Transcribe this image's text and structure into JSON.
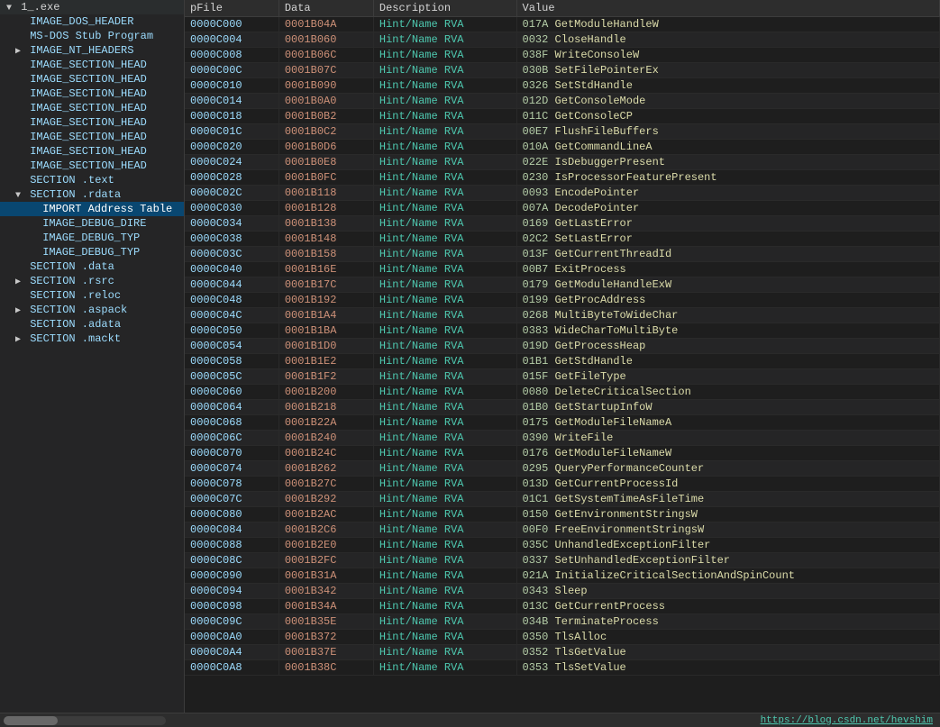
{
  "tree": {
    "root": "1_.exe",
    "items": [
      {
        "id": "dos-header",
        "label": "IMAGE_DOS_HEADER",
        "indent": 1,
        "expandable": false,
        "selected": false
      },
      {
        "id": "ms-dos-stub",
        "label": "MS-DOS Stub Program",
        "indent": 1,
        "expandable": false,
        "selected": false
      },
      {
        "id": "nt-headers",
        "label": "IMAGE_NT_HEADERS",
        "indent": 1,
        "expandable": true,
        "expanded": false,
        "selected": false
      },
      {
        "id": "section-head-1",
        "label": "IMAGE_SECTION_HEAD",
        "indent": 1,
        "expandable": false,
        "selected": false
      },
      {
        "id": "section-head-2",
        "label": "IMAGE_SECTION_HEAD",
        "indent": 1,
        "expandable": false,
        "selected": false
      },
      {
        "id": "section-head-3",
        "label": "IMAGE_SECTION_HEAD",
        "indent": 1,
        "expandable": false,
        "selected": false
      },
      {
        "id": "section-head-4",
        "label": "IMAGE_SECTION_HEAD",
        "indent": 1,
        "expandable": false,
        "selected": false
      },
      {
        "id": "section-head-5",
        "label": "IMAGE_SECTION_HEAD",
        "indent": 1,
        "expandable": false,
        "selected": false
      },
      {
        "id": "section-head-6",
        "label": "IMAGE_SECTION_HEAD",
        "indent": 1,
        "expandable": false,
        "selected": false
      },
      {
        "id": "section-head-7",
        "label": "IMAGE_SECTION_HEAD",
        "indent": 1,
        "expandable": false,
        "selected": false
      },
      {
        "id": "section-head-8",
        "label": "IMAGE_SECTION_HEAD",
        "indent": 1,
        "expandable": false,
        "selected": false
      },
      {
        "id": "section-text",
        "label": "SECTION .text",
        "indent": 1,
        "expandable": false,
        "selected": false
      },
      {
        "id": "section-rdata",
        "label": "SECTION .rdata",
        "indent": 1,
        "expandable": true,
        "expanded": true,
        "selected": false
      },
      {
        "id": "import-addr-table",
        "label": "IMPORT Address Table",
        "indent": 2,
        "expandable": false,
        "selected": true
      },
      {
        "id": "image-debug-dir",
        "label": "IMAGE_DEBUG_DIRE",
        "indent": 2,
        "expandable": false,
        "selected": false
      },
      {
        "id": "image-debug-typ1",
        "label": "IMAGE_DEBUG_TYP",
        "indent": 2,
        "expandable": false,
        "selected": false
      },
      {
        "id": "image-debug-typ2",
        "label": "IMAGE_DEBUG_TYP",
        "indent": 2,
        "expandable": false,
        "selected": false
      },
      {
        "id": "section-data",
        "label": "SECTION .data",
        "indent": 1,
        "expandable": false,
        "selected": false
      },
      {
        "id": "section-rsrc",
        "label": "SECTION .rsrc",
        "indent": 1,
        "expandable": true,
        "expanded": false,
        "selected": false
      },
      {
        "id": "section-reloc",
        "label": "SECTION .reloc",
        "indent": 1,
        "expandable": false,
        "selected": false
      },
      {
        "id": "section-aspack",
        "label": "SECTION .aspack",
        "indent": 1,
        "expandable": true,
        "expanded": false,
        "selected": false
      },
      {
        "id": "section-adata",
        "label": "SECTION .adata",
        "indent": 1,
        "expandable": false,
        "selected": false
      },
      {
        "id": "section-mackt",
        "label": "SECTION .mackt",
        "indent": 1,
        "expandable": true,
        "expanded": false,
        "selected": false
      }
    ]
  },
  "table": {
    "headers": [
      "pFile",
      "Data",
      "Description",
      "Value"
    ],
    "rows": [
      {
        "pfile": "0000C000",
        "data": "0001B04A",
        "desc": "Hint/Name RVA",
        "val_id": "017A",
        "func": "GetModuleHandleW"
      },
      {
        "pfile": "0000C004",
        "data": "0001B060",
        "desc": "Hint/Name RVA",
        "val_id": "0032",
        "func": "CloseHandle"
      },
      {
        "pfile": "0000C008",
        "data": "0001B06C",
        "desc": "Hint/Name RVA",
        "val_id": "038F",
        "func": "WriteConsoleW"
      },
      {
        "pfile": "0000C00C",
        "data": "0001B07C",
        "desc": "Hint/Name RVA",
        "val_id": "030B",
        "func": "SetFilePointerEx"
      },
      {
        "pfile": "0000C010",
        "data": "0001B090",
        "desc": "Hint/Name RVA",
        "val_id": "0326",
        "func": "SetStdHandle"
      },
      {
        "pfile": "0000C014",
        "data": "0001B0A0",
        "desc": "Hint/Name RVA",
        "val_id": "012D",
        "func": "GetConsoleMode"
      },
      {
        "pfile": "0000C018",
        "data": "0001B0B2",
        "desc": "Hint/Name RVA",
        "val_id": "011C",
        "func": "GetConsoleCP"
      },
      {
        "pfile": "0000C01C",
        "data": "0001B0C2",
        "desc": "Hint/Name RVA",
        "val_id": "00E7",
        "func": "FlushFileBuffers"
      },
      {
        "pfile": "0000C020",
        "data": "0001B0D6",
        "desc": "Hint/Name RVA",
        "val_id": "010A",
        "func": "GetCommandLineA"
      },
      {
        "pfile": "0000C024",
        "data": "0001B0E8",
        "desc": "Hint/Name RVA",
        "val_id": "022E",
        "func": "IsDebuggerPresent"
      },
      {
        "pfile": "0000C028",
        "data": "0001B0FC",
        "desc": "Hint/Name RVA",
        "val_id": "0230",
        "func": "IsProcessorFeaturePresent"
      },
      {
        "pfile": "0000C02C",
        "data": "0001B118",
        "desc": "Hint/Name RVA",
        "val_id": "0093",
        "func": "EncodePointer"
      },
      {
        "pfile": "0000C030",
        "data": "0001B128",
        "desc": "Hint/Name RVA",
        "val_id": "007A",
        "func": "DecodePointer"
      },
      {
        "pfile": "0000C034",
        "data": "0001B138",
        "desc": "Hint/Name RVA",
        "val_id": "0169",
        "func": "GetLastError"
      },
      {
        "pfile": "0000C038",
        "data": "0001B148",
        "desc": "Hint/Name RVA",
        "val_id": "02C2",
        "func": "SetLastError"
      },
      {
        "pfile": "0000C03C",
        "data": "0001B158",
        "desc": "Hint/Name RVA",
        "val_id": "013F",
        "func": "GetCurrentThreadId"
      },
      {
        "pfile": "0000C040",
        "data": "0001B16E",
        "desc": "Hint/Name RVA",
        "val_id": "00B7",
        "func": "ExitProcess"
      },
      {
        "pfile": "0000C044",
        "data": "0001B17C",
        "desc": "Hint/Name RVA",
        "val_id": "0179",
        "func": "GetModuleHandleExW"
      },
      {
        "pfile": "0000C048",
        "data": "0001B192",
        "desc": "Hint/Name RVA",
        "val_id": "0199",
        "func": "GetProcAddress"
      },
      {
        "pfile": "0000C04C",
        "data": "0001B1A4",
        "desc": "Hint/Name RVA",
        "val_id": "0268",
        "func": "MultiByteToWideChar"
      },
      {
        "pfile": "0000C050",
        "data": "0001B1BA",
        "desc": "Hint/Name RVA",
        "val_id": "0383",
        "func": "WideCharToMultiByte"
      },
      {
        "pfile": "0000C054",
        "data": "0001B1D0",
        "desc": "Hint/Name RVA",
        "val_id": "019D",
        "func": "GetProcessHeap"
      },
      {
        "pfile": "0000C058",
        "data": "0001B1E2",
        "desc": "Hint/Name RVA",
        "val_id": "01B1",
        "func": "GetStdHandle"
      },
      {
        "pfile": "0000C05C",
        "data": "0001B1F2",
        "desc": "Hint/Name RVA",
        "val_id": "015F",
        "func": "GetFileType"
      },
      {
        "pfile": "0000C060",
        "data": "0001B200",
        "desc": "Hint/Name RVA",
        "val_id": "0080",
        "func": "DeleteCriticalSection"
      },
      {
        "pfile": "0000C064",
        "data": "0001B218",
        "desc": "Hint/Name RVA",
        "val_id": "01B0",
        "func": "GetStartupInfoW"
      },
      {
        "pfile": "0000C068",
        "data": "0001B22A",
        "desc": "Hint/Name RVA",
        "val_id": "0175",
        "func": "GetModuleFileNameA"
      },
      {
        "pfile": "0000C06C",
        "data": "0001B240",
        "desc": "Hint/Name RVA",
        "val_id": "0390",
        "func": "WriteFile"
      },
      {
        "pfile": "0000C070",
        "data": "0001B24C",
        "desc": "Hint/Name RVA",
        "val_id": "0176",
        "func": "GetModuleFileNameW"
      },
      {
        "pfile": "0000C074",
        "data": "0001B262",
        "desc": "Hint/Name RVA",
        "val_id": "0295",
        "func": "QueryPerformanceCounter"
      },
      {
        "pfile": "0000C078",
        "data": "0001B27C",
        "desc": "Hint/Name RVA",
        "val_id": "013D",
        "func": "GetCurrentProcessId"
      },
      {
        "pfile": "0000C07C",
        "data": "0001B292",
        "desc": "Hint/Name RVA",
        "val_id": "01C1",
        "func": "GetSystemTimeAsFileTime"
      },
      {
        "pfile": "0000C080",
        "data": "0001B2AC",
        "desc": "Hint/Name RVA",
        "val_id": "0150",
        "func": "GetEnvironmentStringsW"
      },
      {
        "pfile": "0000C084",
        "data": "0001B2C6",
        "desc": "Hint/Name RVA",
        "val_id": "00F0",
        "func": "FreeEnvironmentStringsW"
      },
      {
        "pfile": "0000C088",
        "data": "0001B2E0",
        "desc": "Hint/Name RVA",
        "val_id": "035C",
        "func": "UnhandledExceptionFilter"
      },
      {
        "pfile": "0000C08C",
        "data": "0001B2FC",
        "desc": "Hint/Name RVA",
        "val_id": "0337",
        "func": "SetUnhandledExceptionFilter"
      },
      {
        "pfile": "0000C090",
        "data": "0001B31A",
        "desc": "Hint/Name RVA",
        "val_id": "021A",
        "func": "InitializeCriticalSectionAndSpinCount"
      },
      {
        "pfile": "0000C094",
        "data": "0001B342",
        "desc": "Hint/Name RVA",
        "val_id": "0343",
        "func": "Sleep"
      },
      {
        "pfile": "0000C098",
        "data": "0001B34A",
        "desc": "Hint/Name RVA",
        "val_id": "013C",
        "func": "GetCurrentProcess"
      },
      {
        "pfile": "0000C09C",
        "data": "0001B35E",
        "desc": "Hint/Name RVA",
        "val_id": "034B",
        "func": "TerminateProcess"
      },
      {
        "pfile": "0000C0A0",
        "data": "0001B372",
        "desc": "Hint/Name RVA",
        "val_id": "0350",
        "func": "TlsAlloc"
      },
      {
        "pfile": "0000C0A4",
        "data": "0001B37E",
        "desc": "Hint/Name RVA",
        "val_id": "0352",
        "func": "TlsGetValue"
      },
      {
        "pfile": "0000C0A8",
        "data": "0001B38C",
        "desc": "Hint/Name RVA",
        "val_id": "0353",
        "func": "TlsSetValue"
      }
    ]
  },
  "bottom_link": "https://blog.csdn.net/hevshim"
}
